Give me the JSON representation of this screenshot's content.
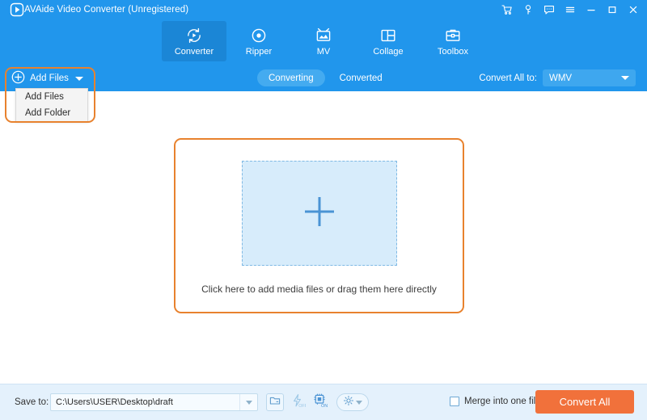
{
  "window": {
    "title": "AVAide Video Converter (Unregistered)",
    "logo_icon": "play-logo-icon",
    "controls": [
      {
        "name": "cart-icon",
        "label": "Buy"
      },
      {
        "name": "key-icon",
        "label": "Register"
      },
      {
        "name": "feedback-icon",
        "label": "Feedback"
      },
      {
        "name": "menu-icon",
        "label": "Menu"
      },
      {
        "name": "minimize-icon",
        "label": "Minimize"
      },
      {
        "name": "maximize-icon",
        "label": "Maximize"
      },
      {
        "name": "close-icon",
        "label": "Close"
      }
    ]
  },
  "nav": {
    "tabs": [
      {
        "label": "Converter",
        "icon": "converter-icon",
        "active": true
      },
      {
        "label": "Ripper",
        "icon": "ripper-icon",
        "active": false
      },
      {
        "label": "MV",
        "icon": "mv-icon",
        "active": false
      },
      {
        "label": "Collage",
        "icon": "collage-icon",
        "active": false
      },
      {
        "label": "Toolbox",
        "icon": "toolbox-icon",
        "active": false
      }
    ]
  },
  "toolbar": {
    "add_files_label": "Add Files",
    "add_files_icon": "plus-circle-icon",
    "dropdown_open": true,
    "dropdown_items": [
      {
        "label": "Add Files"
      },
      {
        "label": "Add Folder"
      }
    ],
    "segments": [
      {
        "label": "Converting",
        "active": true
      },
      {
        "label": "Converted",
        "active": false
      }
    ],
    "convert_all_to_label": "Convert All to:",
    "convert_all_to_value": "WMV"
  },
  "main": {
    "dropzone_text": "Click here to add media files or drag them here directly",
    "dropzone_icon": "plus-icon"
  },
  "footer": {
    "save_to_label": "Save to:",
    "save_to_path": "C:\\Users\\USER\\Desktop\\draft",
    "buttons": [
      {
        "name": "open-folder-icon",
        "label": "Open output folder"
      },
      {
        "name": "hardware-acceleration-icon",
        "label": "OFF"
      },
      {
        "name": "gpu-acceleration-icon",
        "label": "ON"
      },
      {
        "name": "settings-gear-icon",
        "label": "Settings"
      }
    ],
    "merge_label": "Merge into one file",
    "merge_checked": false,
    "convert_all_label": "Convert All"
  },
  "colors": {
    "header_blue": "#2196ec",
    "tab_active_blue": "#1b86d6",
    "accent_orange": "#e8822e",
    "convert_button_orange": "#f1713b",
    "footer_blue": "#e4f1fc",
    "dropzone_fill": "#d7ecfb"
  }
}
